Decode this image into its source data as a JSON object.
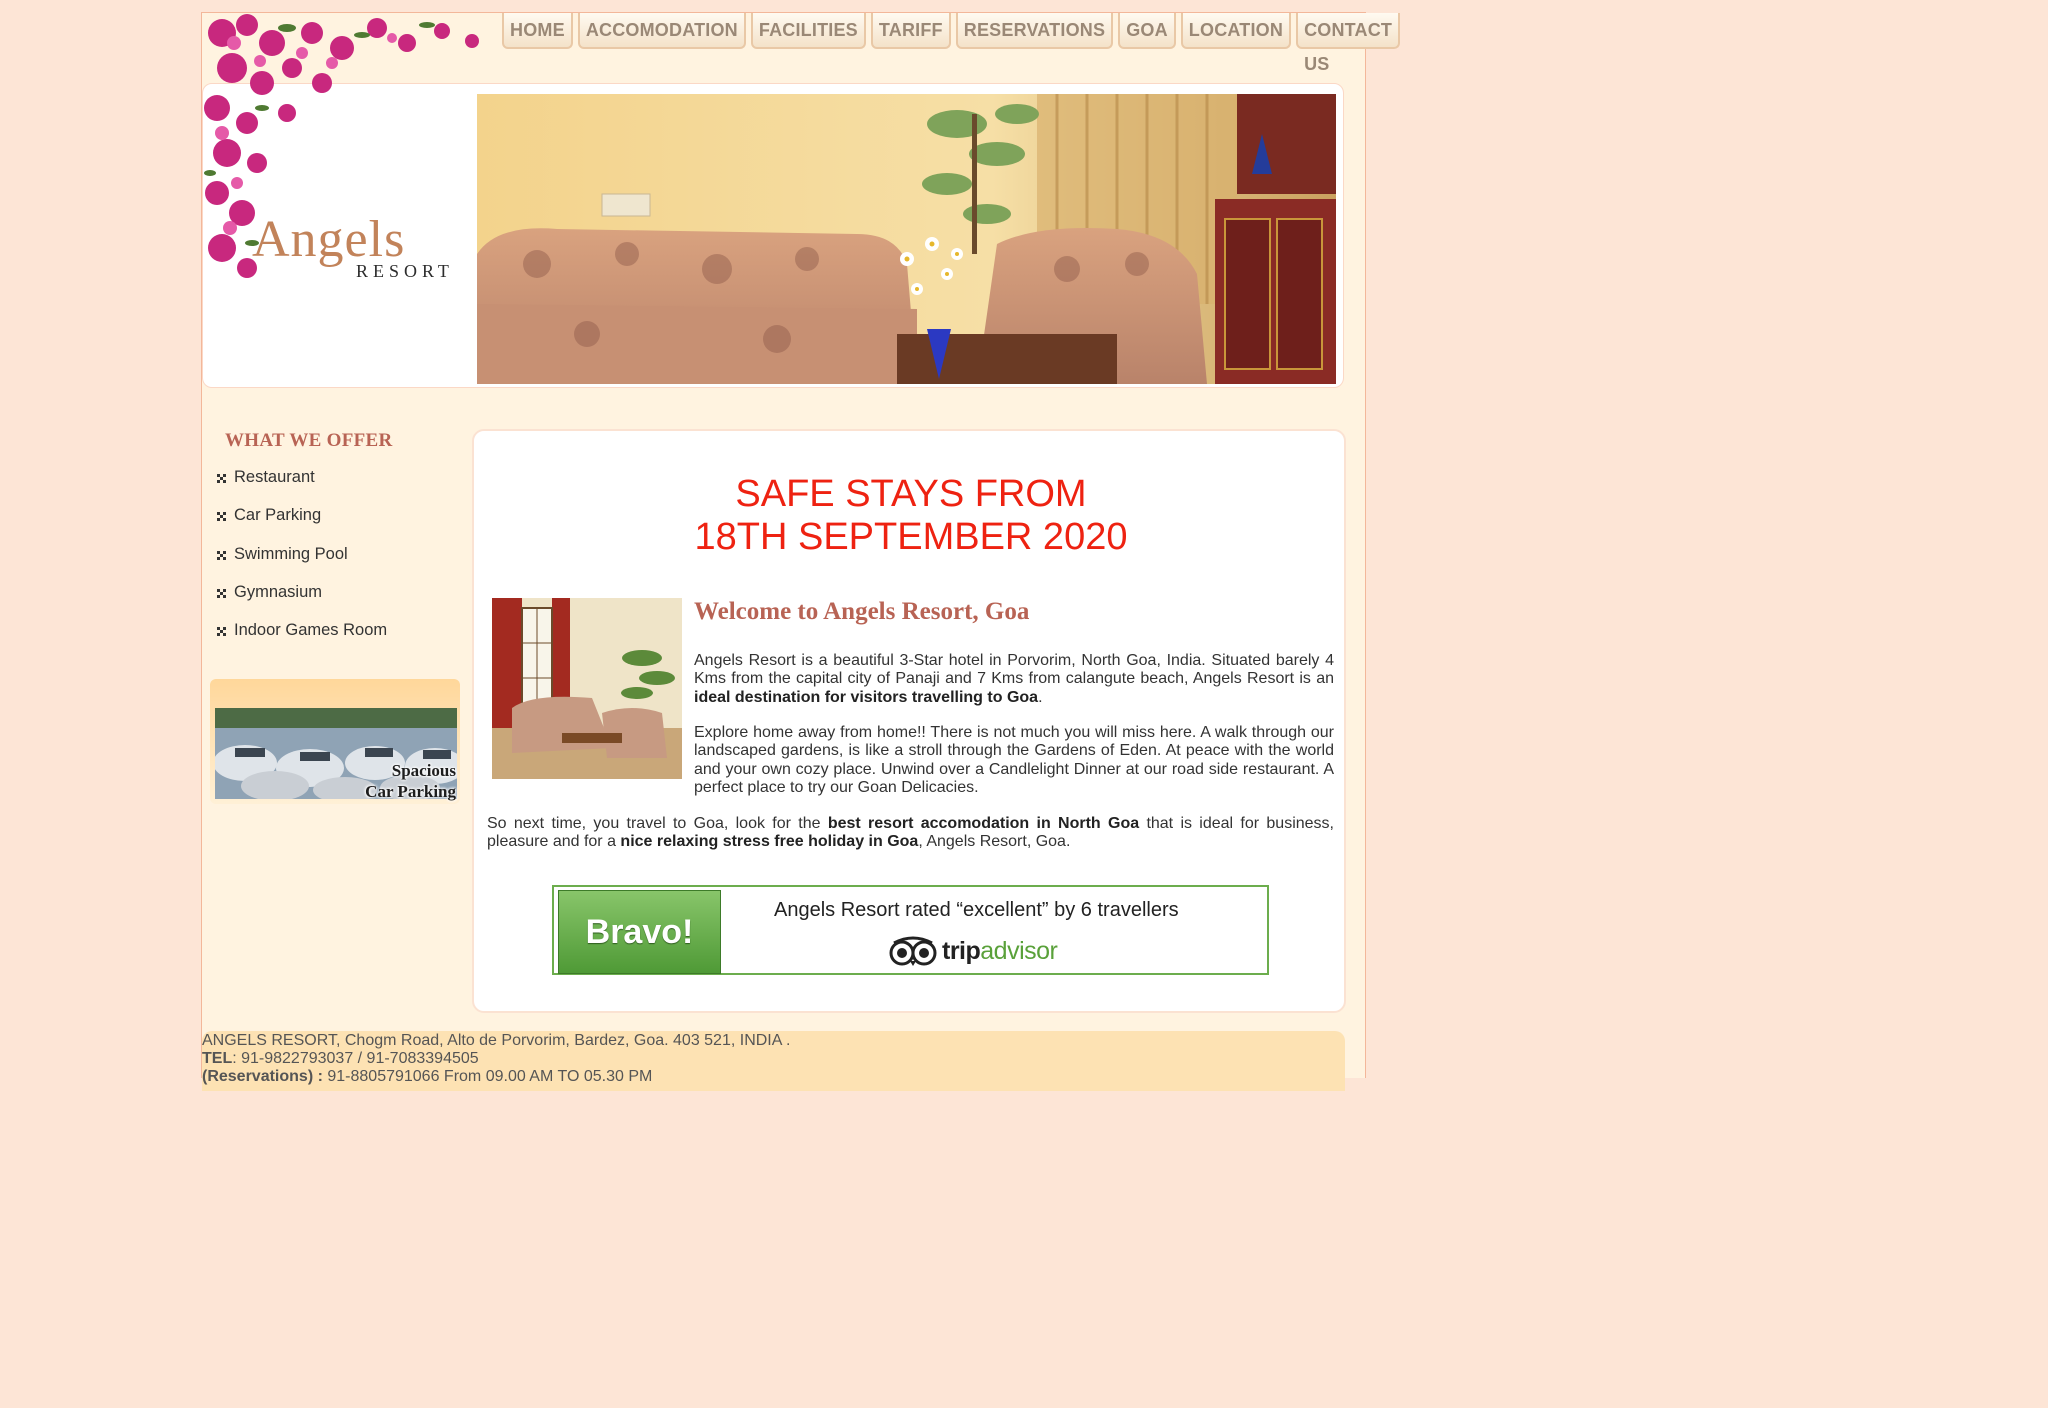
{
  "nav": {
    "items": [
      "HOME",
      "ACCOMODATION",
      "FACILITIES",
      "TARIFF",
      "RESERVATIONS",
      "GOA",
      "LOCATION",
      "CONTACT US"
    ]
  },
  "logo": {
    "main": "Angels",
    "sub": "RESORT"
  },
  "sidebar": {
    "title": "WHAT WE OFFER",
    "items": [
      "Restaurant",
      "Car Parking",
      "Swimming Pool",
      "Gymnasium",
      "Indoor Games Room"
    ],
    "parking_caption_line1": "Spacious",
    "parking_caption_line2": "Car Parking"
  },
  "main": {
    "headline_line1": "SAFE STAYS FROM",
    "headline_line2": "18TH SEPTEMBER 2020",
    "welcome_title": "Welcome to Angels Resort, Goa",
    "p1_a": "Angels Resort is a beautiful 3-Star hotel in Porvorim, North Goa, India. Situated barely 4 Kms from the capital city of Panaji and 7 Kms from calangute beach, Angels Resort is an ",
    "p1_b": "ideal destination for visitors travelling to Goa",
    "p1_c": ".",
    "p2": "Explore home away from home!! There is not much you will miss here. A walk through our landscaped gardens, is like a stroll through the Gardens of Eden. At peace with the world and your own cozy place. Unwind over a Candlelight Dinner at our road side restaurant. A perfect place to try our Goan Delicacies.",
    "p3_a": "So next time, you travel to Goa, look for the ",
    "p3_b": "best resort accomodation in North Goa",
    "p3_c": " that is ideal for business, pleasure and for a ",
    "p3_d": "nice relaxing stress free holiday in Goa",
    "p3_e": ", Angels Resort, Goa."
  },
  "tripadvisor": {
    "badge": "Bravo!",
    "rating_text": "Angels Resort rated “excellent” by 6 travellers",
    "brand_a": "trip",
    "brand_b": "advisor"
  },
  "footer": {
    "address": " ANGELS RESORT, Chogm Road, Alto de Porvorim, Bardez, Goa. 403 521, INDIA .",
    "tel_label": "TEL",
    "tel_value": ": 91-9822793037 / 91-7083394505",
    "res_label": "(Reservations) :",
    "res_value": " 91-8805791066 From 09.00 AM TO 05.30 PM"
  },
  "colors": {
    "accent": "#b86354",
    "headline": "#ee2211",
    "background": "#fde5d6"
  }
}
